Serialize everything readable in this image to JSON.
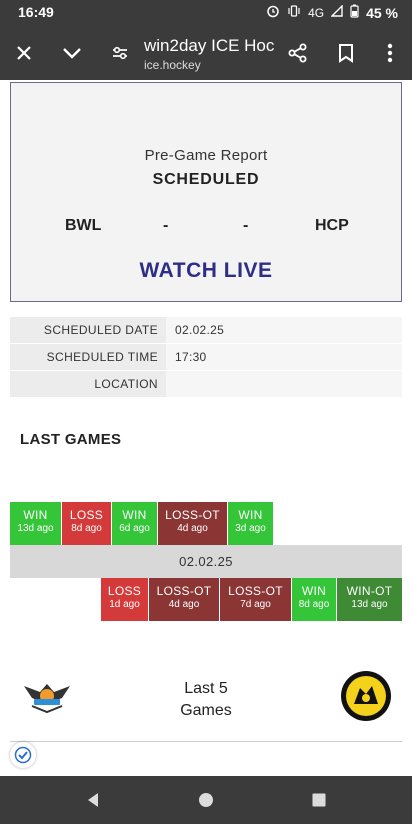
{
  "status_bar": {
    "time": "16:49",
    "network": "4G",
    "battery": "45 %"
  },
  "toolbar": {
    "title": "win2day ICE Hoc…",
    "url": "ice.hockey",
    "icons": [
      "close-icon",
      "chevron-down-icon",
      "settings-icon",
      "share-icon",
      "bookmark-icon",
      "more-icon"
    ]
  },
  "report": {
    "label": "Pre-Game Report",
    "status": "SCHEDULED",
    "home_team": "BWL",
    "home_score": "-",
    "away_score": "-",
    "away_team": "HCP",
    "watch_live": "WATCH LIVE"
  },
  "info": {
    "rows": [
      {
        "key": "SCHEDULED DATE",
        "value": "02.02.25"
      },
      {
        "key": "SCHEDULED TIME",
        "value": "17:30"
      },
      {
        "key": "LOCATION",
        "value": ""
      }
    ]
  },
  "last_games": {
    "title": "LAST GAMES",
    "home_games": [
      {
        "result": "WIN",
        "ago": "13d ago",
        "kind": "win"
      },
      {
        "result": "LOSS",
        "ago": "8d ago",
        "kind": "loss"
      },
      {
        "result": "WIN",
        "ago": "6d ago",
        "kind": "win"
      },
      {
        "result": "LOSS-OT",
        "ago": "4d ago",
        "kind": "lossot"
      },
      {
        "result": "WIN",
        "ago": "3d ago",
        "kind": "win"
      }
    ],
    "date": "02.02.25",
    "away_games": [
      {
        "result": "LOSS",
        "ago": "1d ago",
        "kind": "loss"
      },
      {
        "result": "LOSS-OT",
        "ago": "4d ago",
        "kind": "lossot"
      },
      {
        "result": "LOSS-OT",
        "ago": "7d ago",
        "kind": "lossot"
      },
      {
        "result": "WIN",
        "ago": "8d ago",
        "kind": "win"
      },
      {
        "result": "WIN-OT",
        "ago": "13d ago",
        "kind": "winot"
      }
    ]
  },
  "footer": {
    "line1": "Last 5",
    "line2": "Games"
  },
  "colors": {
    "accent": "#2e2e86",
    "win": "#34c539",
    "loss": "#d43a3a",
    "loss_ot": "#8b3535",
    "win_ot": "#3e8a35"
  }
}
